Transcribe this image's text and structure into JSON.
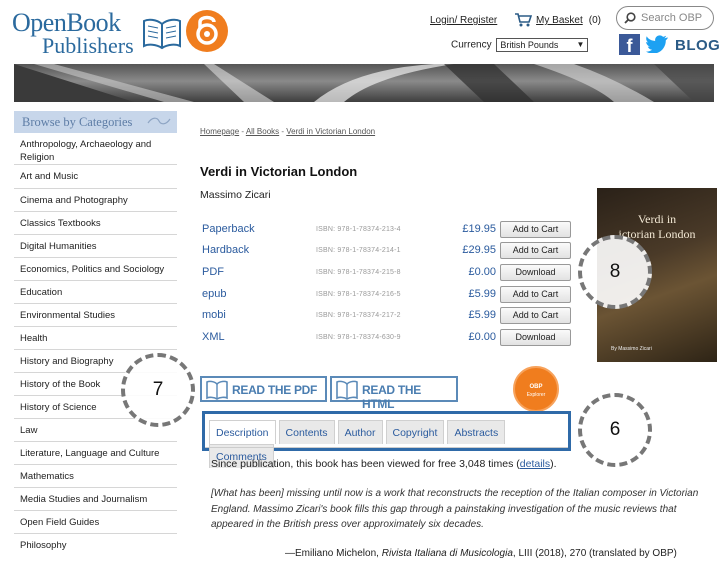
{
  "header": {
    "logo_line1": "OpenBook",
    "logo_line2": "Publishers",
    "login_link": "Login/ Register",
    "basket_label": "My Basket",
    "basket_count": "(0)",
    "currency_label": "Currency",
    "currency_value": "British Pounds",
    "search_placeholder": "Search OBP",
    "blog_label": "BLOG"
  },
  "sidebar": {
    "header": "Browse by Categories",
    "items": [
      {
        "label": "Anthropology, Archaeology and Religion"
      },
      {
        "label": "Art and Music"
      },
      {
        "label": "Cinema and Photography"
      },
      {
        "label": "Classics Textbooks"
      },
      {
        "label": "Digital Humanities"
      },
      {
        "label": "Economics, Politics and Sociology"
      },
      {
        "label": "Education"
      },
      {
        "label": "Environmental Studies"
      },
      {
        "label": "Health"
      },
      {
        "label": "History and Biography"
      },
      {
        "label": "History of the Book"
      },
      {
        "label": "History of Science"
      },
      {
        "label": "Law"
      },
      {
        "label": "Literature, Language and Culture"
      },
      {
        "label": "Mathematics"
      },
      {
        "label": "Media Studies and Journalism"
      },
      {
        "label": "Open Field Guides"
      },
      {
        "label": "Philosophy"
      }
    ]
  },
  "breadcrumb": {
    "home": "Homepage",
    "sep": " - ",
    "all_books": "All Books",
    "current": "Verdi in Victorian London"
  },
  "book": {
    "title": "Verdi in Victorian London",
    "author": "Massimo Zicari",
    "cover_title_1": "Verdi in",
    "cover_title_2": "ictorian London",
    "cover_author": "By Massimo Zicari"
  },
  "formats": [
    {
      "name": "Paperback",
      "isbn": "ISBN: 978-1-78374-213-4",
      "price": "£19.95",
      "action": "Add to Cart"
    },
    {
      "name": "Hardback",
      "isbn": "ISBN: 978-1-78374-214-1",
      "price": "£29.95",
      "action": "Add to Cart"
    },
    {
      "name": "PDF",
      "isbn": "ISBN: 978-1-78374-215-8",
      "price": "£0.00",
      "action": "Download"
    },
    {
      "name": "epub",
      "isbn": "ISBN: 978-1-78374-216-5",
      "price": "£5.99",
      "action": "Add to Cart"
    },
    {
      "name": "mobi",
      "isbn": "ISBN: 978-1-78374-217-2",
      "price": "£5.99",
      "action": "Add to Cart"
    },
    {
      "name": "XML",
      "isbn": "ISBN: 978-1-78374-630-9",
      "price": "£0.00",
      "action": "Download"
    }
  ],
  "read_buttons": {
    "pdf": "READ THE PDF",
    "html": "READ THE HTML"
  },
  "obp_badge": {
    "line1": "OBP",
    "line2": "Explorer"
  },
  "tabs": [
    {
      "label": "Description",
      "active": true
    },
    {
      "label": "Contents",
      "active": false
    },
    {
      "label": "Author",
      "active": false
    },
    {
      "label": "Copyright",
      "active": false
    },
    {
      "label": "Abstracts",
      "active": false
    },
    {
      "label": "Comments",
      "active": false
    }
  ],
  "description": {
    "views_text": "Since publication, this book has been viewed for free 3,048 times (",
    "views_link": "details",
    "views_end": ").",
    "quote": "[What has been] missing until now is a work that reconstructs the reception of the Italian composer in Victorian England. Massimo Zicari's book fills this gap through a painstaking investigation of the music reviews that appeared in the British press over approximately six decades.",
    "quote_src_prefix": "—Emiliano Michelon, ",
    "quote_src_journal": "Rivista Italiana di Musicologia",
    "quote_src_suffix": ", LIII (2018), 270 (translated by OBP)"
  },
  "callouts": {
    "six": "6",
    "seven": "7",
    "eight": "8"
  },
  "colors": {
    "brand_blue": "#2b6a9e",
    "link_blue": "#2b5b9e",
    "accent_orange": "#f07d1e",
    "tab_border": "#2f6aa8"
  }
}
